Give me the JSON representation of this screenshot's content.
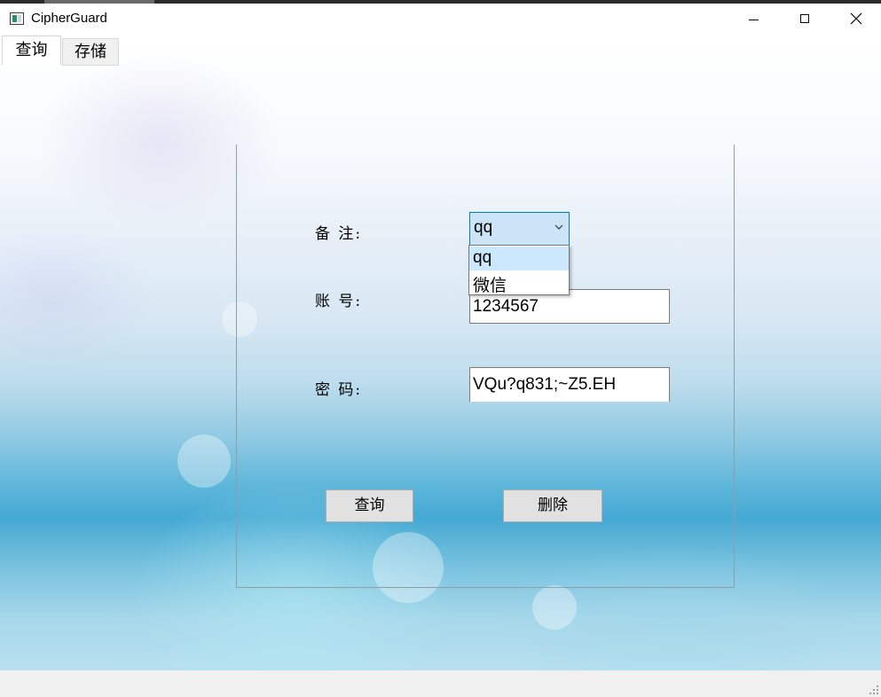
{
  "window": {
    "title": "CipherGuard",
    "controls": {
      "minimize_icon": "minimize-icon",
      "maximize_icon": "maximize-icon",
      "close_icon": "close-icon"
    }
  },
  "tabs": [
    {
      "label": "查询",
      "active": true
    },
    {
      "label": "存储",
      "active": false
    }
  ],
  "form": {
    "remark_label": "备 注:",
    "account_label": "账 号:",
    "password_label": "密 码:",
    "remark_selected": "qq",
    "remark_options": [
      "qq",
      "微信"
    ],
    "account_value": "1234567",
    "password_value": "VQu?q831;~Z5.EH"
  },
  "buttons": {
    "query_label": "查询",
    "delete_label": "删除"
  },
  "colors": {
    "combo_focus": "#cce4f7",
    "combo_border": "#0078d7",
    "option_highlight": "#cce8ff",
    "button_face": "#e1e1e1"
  }
}
